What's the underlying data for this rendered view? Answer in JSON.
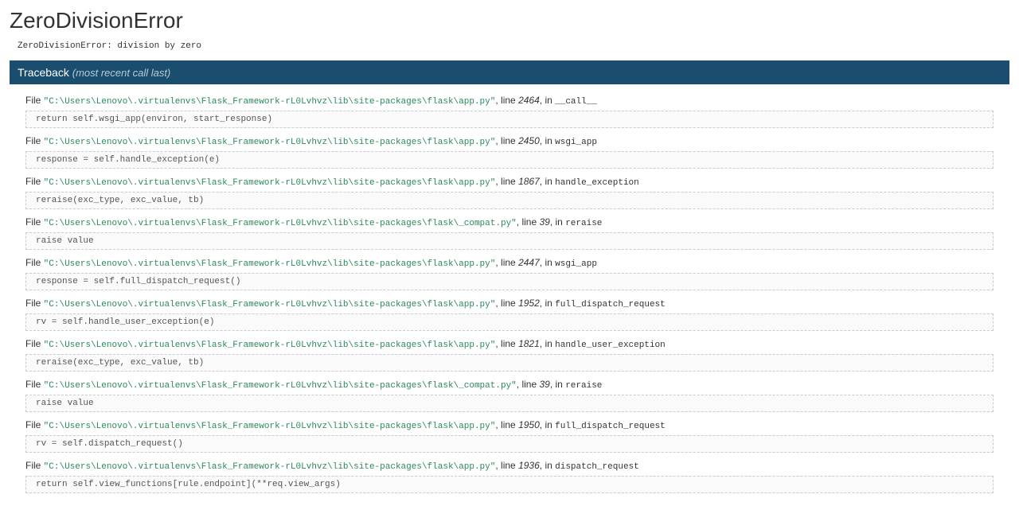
{
  "title": "ZeroDivisionError",
  "message": "ZeroDivisionError: division by zero",
  "traceback_label": "Traceback",
  "traceback_sublabel": "(most recent call last)",
  "file_prefix": "File",
  "line_prefix": "line",
  "in_prefix": "in",
  "frames": [
    {
      "path": "\"C:\\Users\\Lenovo\\.virtualenvs\\Flask_Framework-rL0Lvhvz\\lib\\site-packages\\flask\\app.py\"",
      "line": "2464",
      "func": "__call__",
      "code": "return self.wsgi_app(environ, start_response)"
    },
    {
      "path": "\"C:\\Users\\Lenovo\\.virtualenvs\\Flask_Framework-rL0Lvhvz\\lib\\site-packages\\flask\\app.py\"",
      "line": "2450",
      "func": "wsgi_app",
      "code": "response = self.handle_exception(e)"
    },
    {
      "path": "\"C:\\Users\\Lenovo\\.virtualenvs\\Flask_Framework-rL0Lvhvz\\lib\\site-packages\\flask\\app.py\"",
      "line": "1867",
      "func": "handle_exception",
      "code": "reraise(exc_type, exc_value, tb)"
    },
    {
      "path": "\"C:\\Users\\Lenovo\\.virtualenvs\\Flask_Framework-rL0Lvhvz\\lib\\site-packages\\flask\\_compat.py\"",
      "line": "39",
      "func": "reraise",
      "code": "raise value"
    },
    {
      "path": "\"C:\\Users\\Lenovo\\.virtualenvs\\Flask_Framework-rL0Lvhvz\\lib\\site-packages\\flask\\app.py\"",
      "line": "2447",
      "func": "wsgi_app",
      "code": "response = self.full_dispatch_request()"
    },
    {
      "path": "\"C:\\Users\\Lenovo\\.virtualenvs\\Flask_Framework-rL0Lvhvz\\lib\\site-packages\\flask\\app.py\"",
      "line": "1952",
      "func": "full_dispatch_request",
      "code": "rv = self.handle_user_exception(e)"
    },
    {
      "path": "\"C:\\Users\\Lenovo\\.virtualenvs\\Flask_Framework-rL0Lvhvz\\lib\\site-packages\\flask\\app.py\"",
      "line": "1821",
      "func": "handle_user_exception",
      "code": "reraise(exc_type, exc_value, tb)"
    },
    {
      "path": "\"C:\\Users\\Lenovo\\.virtualenvs\\Flask_Framework-rL0Lvhvz\\lib\\site-packages\\flask\\_compat.py\"",
      "line": "39",
      "func": "reraise",
      "code": "raise value"
    },
    {
      "path": "\"C:\\Users\\Lenovo\\.virtualenvs\\Flask_Framework-rL0Lvhvz\\lib\\site-packages\\flask\\app.py\"",
      "line": "1950",
      "func": "full_dispatch_request",
      "code": "rv = self.dispatch_request()"
    },
    {
      "path": "\"C:\\Users\\Lenovo\\.virtualenvs\\Flask_Framework-rL0Lvhvz\\lib\\site-packages\\flask\\app.py\"",
      "line": "1936",
      "func": "dispatch_request",
      "code": "return self.view_functions[rule.endpoint](**req.view_args)"
    }
  ]
}
